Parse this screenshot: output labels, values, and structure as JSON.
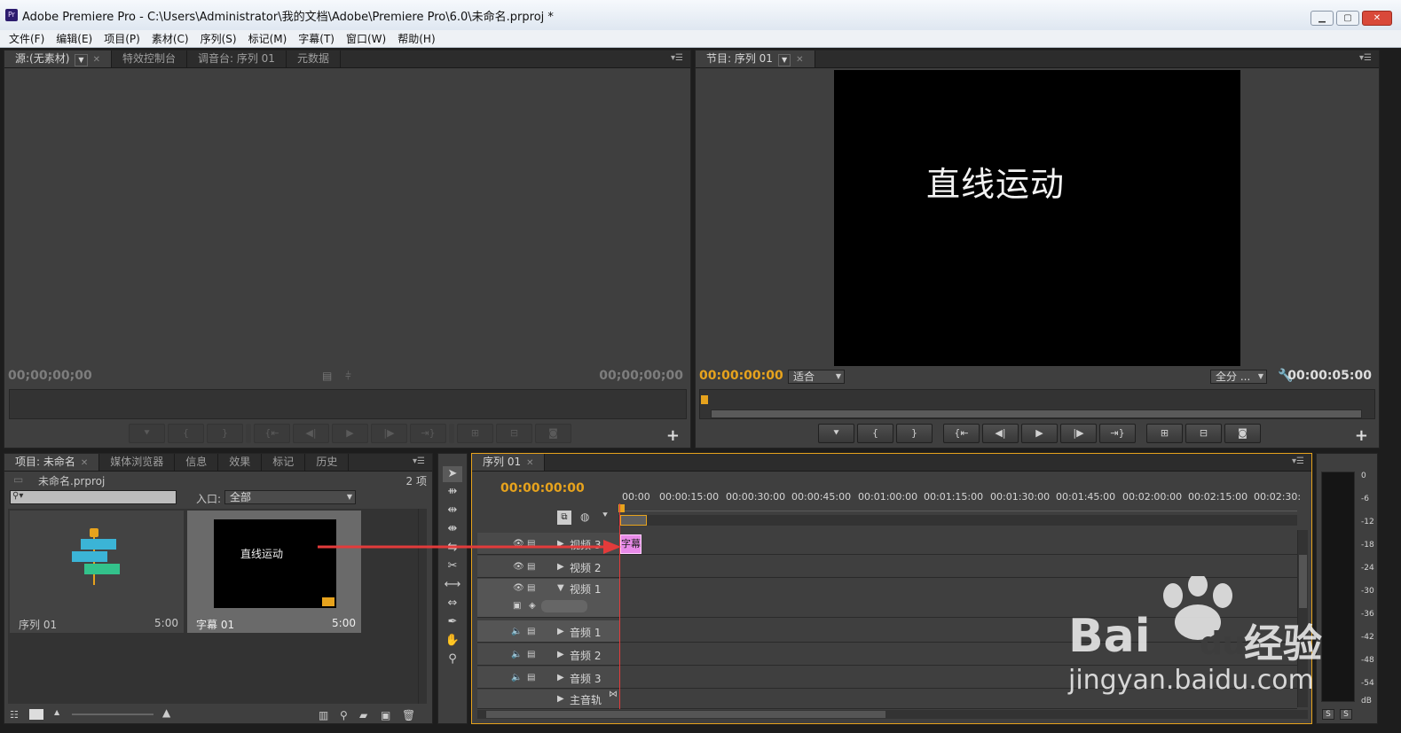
{
  "window": {
    "title": "Adobe Premiere Pro - C:\\Users\\Administrator\\我的文档\\Adobe\\Premiere Pro\\6.0\\未命名.prproj *",
    "logo": "Pr"
  },
  "menu": [
    "文件(F)",
    "编辑(E)",
    "项目(P)",
    "素材(C)",
    "序列(S)",
    "标记(M)",
    "字幕(T)",
    "窗口(W)",
    "帮助(H)"
  ],
  "source_panel": {
    "tabs": [
      "源:(无素材)",
      "特效控制台",
      "调音台: 序列 01",
      "元数据"
    ],
    "timecode_left": "00;00;00;00",
    "timecode_right": "00;00;00;00"
  },
  "program_panel": {
    "tab": "节目: 序列 01",
    "timecode_left": "00:00:00:00",
    "fit": "适合",
    "quality": "全分 ...",
    "timecode_right": "00:00:05:00",
    "overlay_text": "直线运动"
  },
  "transport_icons": [
    "marker-icon",
    "in-point-icon",
    "out-point-icon",
    "go-to-in-icon",
    "step-back-icon",
    "play-icon",
    "step-forward-icon",
    "go-to-out-icon",
    "lift-icon",
    "extract-icon",
    "export-frame-icon"
  ],
  "project_panel": {
    "tabs": [
      "项目: 未命名",
      "媒体浏览器",
      "信息",
      "效果",
      "标记",
      "历史"
    ],
    "file": "未命名.prproj",
    "count": "2 项",
    "inlet_label": "入口:",
    "inlet_value": "全部",
    "items": [
      {
        "name": "序列 01",
        "dur": "5:00"
      },
      {
        "name": "字幕 01",
        "dur": "5:00",
        "thumb_text": "直线运动"
      }
    ]
  },
  "timeline": {
    "tab": "序列 01",
    "timecode": "00:00:00:00",
    "ruler": [
      "00:00",
      "00:00:15:00",
      "00:00:30:00",
      "00:00:45:00",
      "00:01:00:00",
      "00:01:15:00",
      "00:01:30:00",
      "00:01:45:00",
      "00:02:00:00",
      "00:02:15:00",
      "00:02:30:"
    ],
    "tracks": [
      "视频 3",
      "视频 2",
      "视频 1",
      "音频 1",
      "音频 2",
      "音频 3",
      "主音轨"
    ],
    "clip_label": "字幕"
  },
  "meters": {
    "scale": [
      "0",
      "-6",
      "-12",
      "-18",
      "-24",
      "-30",
      "-36",
      "-42",
      "-48",
      "-54",
      "dB"
    ],
    "solo": [
      "S",
      "S"
    ]
  },
  "watermark": {
    "brand": "Bai",
    "brand2": "du",
    "cn": "经验",
    "url": "jingyan.baidu.com"
  },
  "colors": {
    "timecode": "#e7a31d",
    "clip": "#e88ae8",
    "arrow": "#e33b3b",
    "playhead": "#e33b3b"
  }
}
